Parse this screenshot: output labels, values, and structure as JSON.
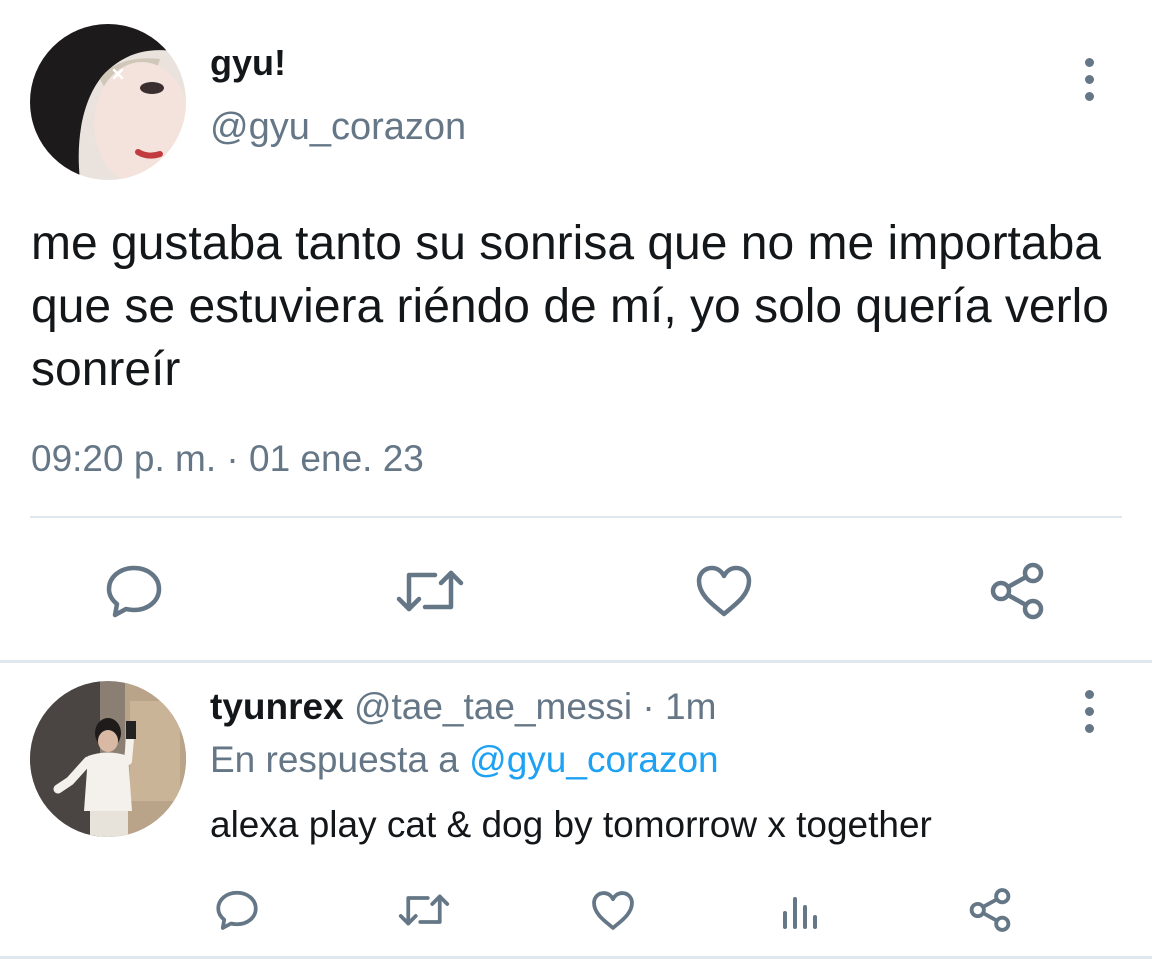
{
  "main_tweet": {
    "display_name": "gyu!",
    "handle": "@gyu_corazon",
    "text": "me gustaba tanto su sonrisa que no me importaba que se estuviera riéndo de mí, yo solo quería verlo sonreír",
    "timestamp": "09:20 p. m. · 01 ene. 23",
    "actions": [
      "reply-icon",
      "retweet-icon",
      "like-icon",
      "share-icon"
    ]
  },
  "reply_tweet": {
    "display_name": "tyunrex",
    "handle": "@tae_tae_messi",
    "separator": " · ",
    "time": "1m",
    "replying_prefix": "En respuesta a ",
    "replying_to": "@gyu_corazon",
    "text": "alexa play cat & dog by tomorrow x together",
    "actions": [
      "reply-icon",
      "retweet-icon",
      "like-icon",
      "analytics-icon",
      "share-icon"
    ]
  },
  "colors": {
    "text": "#14171a",
    "secondary": "#657786",
    "link": "#1da1f2",
    "divider": "#e1e8ed"
  }
}
